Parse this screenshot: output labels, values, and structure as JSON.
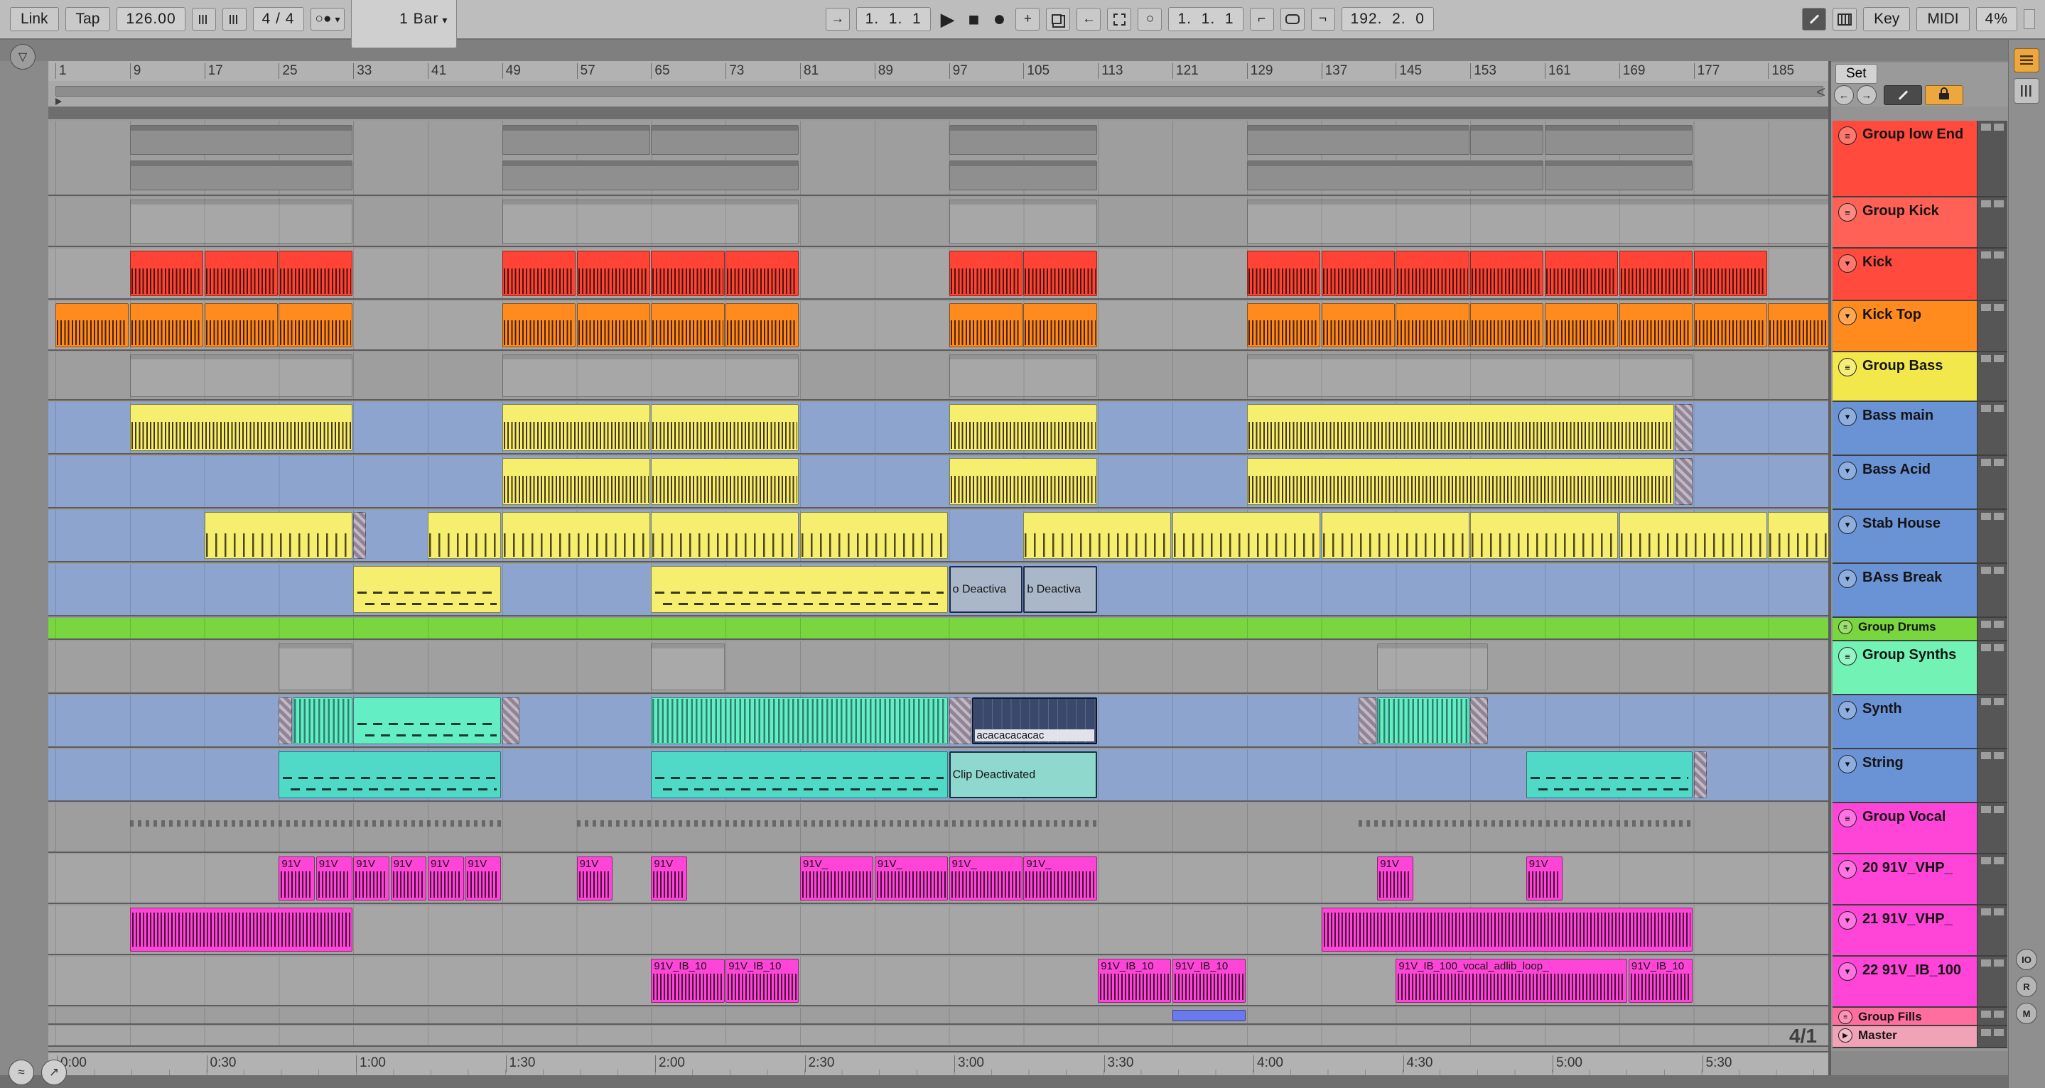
{
  "toolbar": {
    "link_label": "Link",
    "tap_label": "Tap",
    "tempo": "126.00",
    "time_signature": "4 / 4",
    "quantization": "1 Bar",
    "arrangement_position": "1.  1.  1",
    "loop_start": "1.  1.  1",
    "loop_length": "192.  2.  0",
    "key_label": "Key",
    "midi_label": "MIDI",
    "cpu": "4%"
  },
  "icons": {
    "follow": "→",
    "metronome": "○●",
    "chevron_down": "▾",
    "play": "▶",
    "stop": "■",
    "record": "●",
    "overdub": "+",
    "reenable_automation": "←",
    "session_record": "○",
    "punch_in": "⌐",
    "punch_out": "¬",
    "group_fold": "≡",
    "track_fold": "▾",
    "master_play": "▶",
    "fold_all": "▽",
    "prev_set": "←",
    "next_set": "→",
    "wave_tool": "≈",
    "pan_tool": "↗"
  },
  "set_panel": {
    "label": "Set"
  },
  "scrub": {
    "loop_end_marker": "<"
  },
  "master": {
    "time_signature_marker": "4/1"
  },
  "right_strip": {
    "toggles": [
      "IO",
      "R",
      "M"
    ]
  },
  "bar_ruler": {
    "labels": [
      1,
      9,
      17,
      25,
      33,
      41,
      49,
      57,
      65,
      73,
      81,
      89,
      97,
      105,
      113,
      121,
      129,
      137,
      145,
      153,
      161,
      169,
      177,
      185
    ]
  },
  "time_ruler": {
    "labels": [
      "0:00",
      "0:30",
      "1:00",
      "1:30",
      "2:00",
      "2:30",
      "3:00",
      "3:30",
      "4:00",
      "4:30",
      "5:00",
      "5:30"
    ]
  },
  "tracks": [
    {
      "name": "Group low End",
      "kind": "group",
      "color": "#ff4a3d",
      "h": 106,
      "lane_bg": "#9e9e9e",
      "clips": [
        {
          "s": 9,
          "l": 24,
          "t": "mini",
          "c": "",
          "r": 0
        },
        {
          "s": 49,
          "l": 16,
          "t": "mini",
          "c": "",
          "r": 0
        },
        {
          "s": 65,
          "l": 16,
          "t": "mini",
          "c": "",
          "r": 0
        },
        {
          "s": 97,
          "l": 16,
          "t": "mini",
          "c": "",
          "r": 0
        },
        {
          "s": 129,
          "l": 24,
          "t": "mini",
          "c": "",
          "r": 0
        },
        {
          "s": 153,
          "l": 8,
          "t": "mini",
          "c": "",
          "r": 0
        },
        {
          "s": 161,
          "l": 16,
          "t": "mini",
          "c": "",
          "r": 0
        },
        {
          "s": 9,
          "l": 24,
          "t": "mini",
          "c": "",
          "r": 1
        },
        {
          "s": 49,
          "l": 32,
          "t": "mini",
          "c": "",
          "r": 1
        },
        {
          "s": 97,
          "l": 16,
          "t": "mini",
          "c": "",
          "r": 1
        },
        {
          "s": 129,
          "l": 32,
          "t": "mini",
          "c": "",
          "r": 1
        },
        {
          "s": 161,
          "l": 16,
          "t": "mini",
          "c": "",
          "r": 1
        }
      ]
    },
    {
      "name": "Group Kick",
      "kind": "group",
      "color": "#ff6157",
      "h": 70,
      "lane_bg": "#9e9e9e",
      "clips": [
        {
          "s": 9,
          "l": 24,
          "t": "ghost",
          "c": ""
        },
        {
          "s": 49,
          "l": 32,
          "t": "ghost",
          "c": ""
        },
        {
          "s": 97,
          "l": 16,
          "t": "ghost",
          "c": ""
        },
        {
          "s": 129,
          "l": 64,
          "t": "ghost",
          "c": ""
        }
      ]
    },
    {
      "name": "Kick",
      "kind": "track",
      "color": "#ff4a3d",
      "h": 72,
      "lane_bg": "#a6a6a6",
      "clip_color": "#ff4334",
      "clip_type": "midiDense",
      "clips": [
        {
          "s": 9,
          "l": 8
        },
        {
          "s": 17,
          "l": 8
        },
        {
          "s": 25,
          "l": 8
        },
        {
          "s": 49,
          "l": 8
        },
        {
          "s": 57,
          "l": 8
        },
        {
          "s": 65,
          "l": 8
        },
        {
          "s": 73,
          "l": 8
        },
        {
          "s": 97,
          "l": 8
        },
        {
          "s": 105,
          "l": 8
        },
        {
          "s": 129,
          "l": 8
        },
        {
          "s": 137,
          "l": 8
        },
        {
          "s": 145,
          "l": 8
        },
        {
          "s": 153,
          "l": 8
        },
        {
          "s": 161,
          "l": 8
        },
        {
          "s": 169,
          "l": 8
        },
        {
          "s": 177,
          "l": 8
        }
      ]
    },
    {
      "name": "Kick Top",
      "kind": "track",
      "color": "#ff8a1e",
      "h": 70,
      "lane_bg": "#a6a6a6",
      "clip_color": "#ff8a1e",
      "clip_type": "midiDense",
      "clips": [
        {
          "s": 1,
          "l": 8
        },
        {
          "s": 9,
          "l": 8
        },
        {
          "s": 17,
          "l": 8
        },
        {
          "s": 25,
          "l": 8
        },
        {
          "s": 49,
          "l": 8
        },
        {
          "s": 57,
          "l": 8
        },
        {
          "s": 65,
          "l": 8
        },
        {
          "s": 73,
          "l": 8
        },
        {
          "s": 97,
          "l": 8
        },
        {
          "s": 105,
          "l": 8
        },
        {
          "s": 129,
          "l": 8
        },
        {
          "s": 137,
          "l": 8
        },
        {
          "s": 145,
          "l": 8
        },
        {
          "s": 153,
          "l": 8
        },
        {
          "s": 161,
          "l": 8
        },
        {
          "s": 169,
          "l": 8
        },
        {
          "s": 177,
          "l": 8
        },
        {
          "s": 185,
          "l": 8
        }
      ]
    },
    {
      "name": "Group Bass",
      "kind": "group",
      "color": "#f2e84b",
      "h": 68,
      "lane_bg": "#9e9e9e",
      "clips": [
        {
          "s": 9,
          "l": 24,
          "t": "ghost",
          "c": ""
        },
        {
          "s": 49,
          "l": 32,
          "t": "ghost",
          "c": ""
        },
        {
          "s": 97,
          "l": 16,
          "t": "ghost",
          "c": ""
        },
        {
          "s": 129,
          "l": 48,
          "t": "ghost",
          "c": ""
        }
      ]
    },
    {
      "name": "Bass main",
      "kind": "track",
      "color": "#6a93d6",
      "h": 74,
      "lane_bg": "#8da5ce",
      "clip_color": "#f5ee6e",
      "clip_type": "midiDense",
      "clips": [
        {
          "s": 9,
          "l": 24
        },
        {
          "s": 49,
          "l": 16
        },
        {
          "s": 65,
          "l": 16
        },
        {
          "s": 97,
          "l": 16
        },
        {
          "s": 129,
          "l": 46
        },
        {
          "s": 175,
          "l": 2,
          "t": "hatch",
          "c": ""
        }
      ]
    },
    {
      "name": "Bass Acid",
      "kind": "track",
      "color": "#6a93d6",
      "h": 74,
      "lane_bg": "#8da5ce",
      "clip_color": "#f5ee6e",
      "clip_type": "midiDense",
      "clips": [
        {
          "s": 49,
          "l": 16
        },
        {
          "s": 65,
          "l": 16
        },
        {
          "s": 97,
          "l": 16
        },
        {
          "s": 129,
          "l": 46
        },
        {
          "s": 175,
          "l": 2,
          "t": "hatch",
          "c": ""
        }
      ]
    },
    {
      "name": "Stab House",
      "kind": "track",
      "color": "#6a93d6",
      "h": 74,
      "lane_bg": "#8da5ce",
      "clip_color": "#f5ee6e",
      "clip_type": "midiSparse",
      "clips": [
        {
          "s": 17,
          "l": 16
        },
        {
          "s": 33,
          "l": 1.5,
          "t": "hatch",
          "c": ""
        },
        {
          "s": 41,
          "l": 8
        },
        {
          "s": 49,
          "l": 16
        },
        {
          "s": 65,
          "l": 16
        },
        {
          "s": 81,
          "l": 16
        },
        {
          "s": 105,
          "l": 16
        },
        {
          "s": 121,
          "l": 16
        },
        {
          "s": 137,
          "l": 16
        },
        {
          "s": 153,
          "l": 16
        },
        {
          "s": 169,
          "l": 16
        },
        {
          "s": 185,
          "l": 7
        }
      ]
    },
    {
      "name": "BAss Break",
      "kind": "track",
      "color": "#6a93d6",
      "h": 74,
      "lane_bg": "#8da5ce",
      "clips": [
        {
          "s": 33,
          "l": 16,
          "t": "dash",
          "c": "#f5ee6e"
        },
        {
          "s": 65,
          "l": 32,
          "t": "dash",
          "c": "#f5ee6e"
        },
        {
          "s": 97,
          "l": 8,
          "t": "deact",
          "c": "",
          "label": "o Deactiva"
        },
        {
          "s": 105,
          "l": 8,
          "t": "deact",
          "c": "",
          "label": "b Deactiva"
        }
      ]
    },
    {
      "name": "Group Drums",
      "kind": "group",
      "color": "#79d63f",
      "h": 31,
      "lane_bg": "#79d63f",
      "clips": []
    },
    {
      "name": "Group Synths",
      "kind": "group",
      "color": "#72f2b4",
      "h": 74,
      "lane_bg": "#a0a0a0",
      "clips": [
        {
          "s": 25,
          "l": 8,
          "t": "ghost",
          "c": ""
        },
        {
          "s": 65,
          "l": 8,
          "t": "ghost",
          "c": ""
        },
        {
          "s": 143,
          "l": 12,
          "t": "ghost",
          "c": ""
        }
      ]
    },
    {
      "name": "Synth",
      "kind": "track",
      "color": "#6a93d6",
      "h": 74,
      "lane_bg": "#8da5ce",
      "clip_color": "#63eec4",
      "clips": [
        {
          "s": 25,
          "l": 1.5,
          "t": "hatch",
          "c": ""
        },
        {
          "s": 26.5,
          "l": 6.5,
          "t": "stripe"
        },
        {
          "s": 33,
          "l": 16,
          "t": "dash"
        },
        {
          "s": 49,
          "l": 2,
          "t": "hatch",
          "c": ""
        },
        {
          "s": 65,
          "l": 32,
          "t": "stripe"
        },
        {
          "s": 97,
          "l": 2.5,
          "t": "hatch",
          "c": ""
        },
        {
          "s": 99.5,
          "l": 13.5,
          "t": "dark",
          "c": "",
          "label": "acacacacacac"
        },
        {
          "s": 141,
          "l": 2,
          "t": "hatch",
          "c": ""
        },
        {
          "s": 143,
          "l": 10,
          "t": "stripe"
        },
        {
          "s": 153,
          "l": 2,
          "t": "hatch",
          "c": ""
        }
      ]
    },
    {
      "name": "String",
      "kind": "track",
      "color": "#6a93d6",
      "h": 74,
      "lane_bg": "#8da5ce",
      "clip_color": "#4fd9c6",
      "clips": [
        {
          "s": 25,
          "l": 24,
          "t": "dash"
        },
        {
          "s": 65,
          "l": 32,
          "t": "dash"
        },
        {
          "s": 97,
          "l": 16,
          "t": "deactTeal",
          "c": "",
          "label": "Clip Deactivated"
        },
        {
          "s": 159,
          "l": 18,
          "t": "dash"
        },
        {
          "s": 177,
          "l": 1.5,
          "t": "hatch",
          "c": ""
        }
      ]
    },
    {
      "name": "Group Vocal",
      "kind": "group",
      "color": "#ff44d8",
      "h": 70,
      "lane_bg": "#9e9e9e",
      "clips": [
        {
          "s": 9,
          "l": 40,
          "t": "dots",
          "c": ""
        },
        {
          "s": 57,
          "l": 56,
          "t": "dots",
          "c": ""
        },
        {
          "s": 141,
          "l": 36,
          "t": "dots",
          "c": ""
        }
      ]
    },
    {
      "name": "20 91V_VHP_",
      "kind": "track",
      "color": "#ff44d8",
      "h": 70,
      "lane_bg": "#a6a6a6",
      "clip_color": "#ff44d8",
      "clip_type": "wave",
      "clips": [
        {
          "s": 25,
          "l": 4,
          "label": "91V"
        },
        {
          "s": 29,
          "l": 4,
          "label": "91V"
        },
        {
          "s": 33,
          "l": 4,
          "label": "91V"
        },
        {
          "s": 37,
          "l": 4,
          "label": "91V"
        },
        {
          "s": 41,
          "l": 4,
          "label": "91V"
        },
        {
          "s": 45,
          "l": 4,
          "label": "91V"
        },
        {
          "s": 57,
          "l": 4,
          "label": "91V"
        },
        {
          "s": 65,
          "l": 4,
          "label": "91V"
        },
        {
          "s": 81,
          "l": 8,
          "label": "91V_"
        },
        {
          "s": 89,
          "l": 8,
          "label": "91V_"
        },
        {
          "s": 97,
          "l": 8,
          "label": "91V_"
        },
        {
          "s": 105,
          "l": 8,
          "label": "91V_"
        },
        {
          "s": 143,
          "l": 4,
          "label": "91V"
        },
        {
          "s": 159,
          "l": 4,
          "label": "91V"
        }
      ]
    },
    {
      "name": "21 91V_VHP_",
      "kind": "track",
      "color": "#ff44d8",
      "h": 70,
      "lane_bg": "#a6a6a6",
      "clip_color": "#ff44d8",
      "clips": [
        {
          "s": 9,
          "l": 24,
          "t": "waveBig"
        },
        {
          "s": 137,
          "l": 40,
          "t": "waveBig"
        }
      ]
    },
    {
      "name": "22 91V_IB_100",
      "kind": "track",
      "color": "#ff44d8",
      "h": 70,
      "lane_bg": "#a6a6a6",
      "clip_color": "#ff44d8",
      "clip_type": "wave",
      "clips": [
        {
          "s": 65,
          "l": 8,
          "label": "91V_IB_10"
        },
        {
          "s": 73,
          "l": 8,
          "label": "91V_IB_10"
        },
        {
          "s": 113,
          "l": 8,
          "label": "91V_IB_10"
        },
        {
          "s": 121,
          "l": 8,
          "label": "91V_IB_10"
        },
        {
          "s": 145,
          "l": 25,
          "label": "91V_IB_100_vocal_adlib_loop_"
        },
        {
          "s": 170,
          "l": 7,
          "label": "91V_IB_10"
        }
      ]
    },
    {
      "name": "Group Fills",
      "kind": "group",
      "color": "#ff6e9e",
      "h": 24,
      "lane_bg": "#9e9e9e",
      "clips": [
        {
          "s": 121,
          "l": 8,
          "t": "plain",
          "c": "#6b79ef"
        }
      ]
    },
    {
      "name": "Master",
      "kind": "master",
      "color": "#f0a2b6",
      "h": 29,
      "lane_bg": "#a6a6a6",
      "clips": []
    }
  ]
}
